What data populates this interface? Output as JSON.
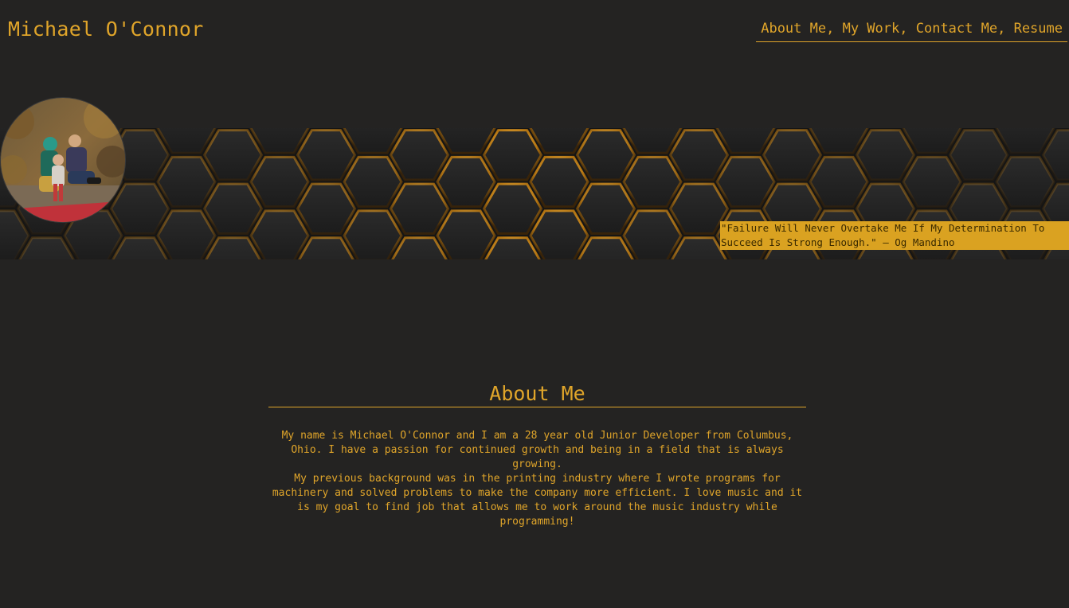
{
  "header": {
    "site_title": "Michael O'Connor",
    "nav": [
      {
        "label": "About Me"
      },
      {
        "label": "My Work"
      },
      {
        "label": "Contact Me"
      },
      {
        "label": "Resume"
      }
    ],
    "nav_separator": ", "
  },
  "hero": {
    "quote": "\"Failure Will Never Overtake Me If My Determination To Succeed Is Strong Enough.\" — Og Mandino"
  },
  "about": {
    "title": "About Me",
    "paragraph_1": "My name is Michael O'Connor and I am a 28 year old Junior Developer from Columbus, Ohio. I have a passion for continued growth and being in a field that is always growing.",
    "paragraph_2": "My previous background was in the printing industry where I wrote programs for machinery and solved problems to make the company more efficient. I love music and it is my goal to find job that allows me to work around the music industry while programming!"
  },
  "colors": {
    "background": "#242322",
    "accent": "#e0a52a",
    "quote_bg": "#daa221"
  }
}
